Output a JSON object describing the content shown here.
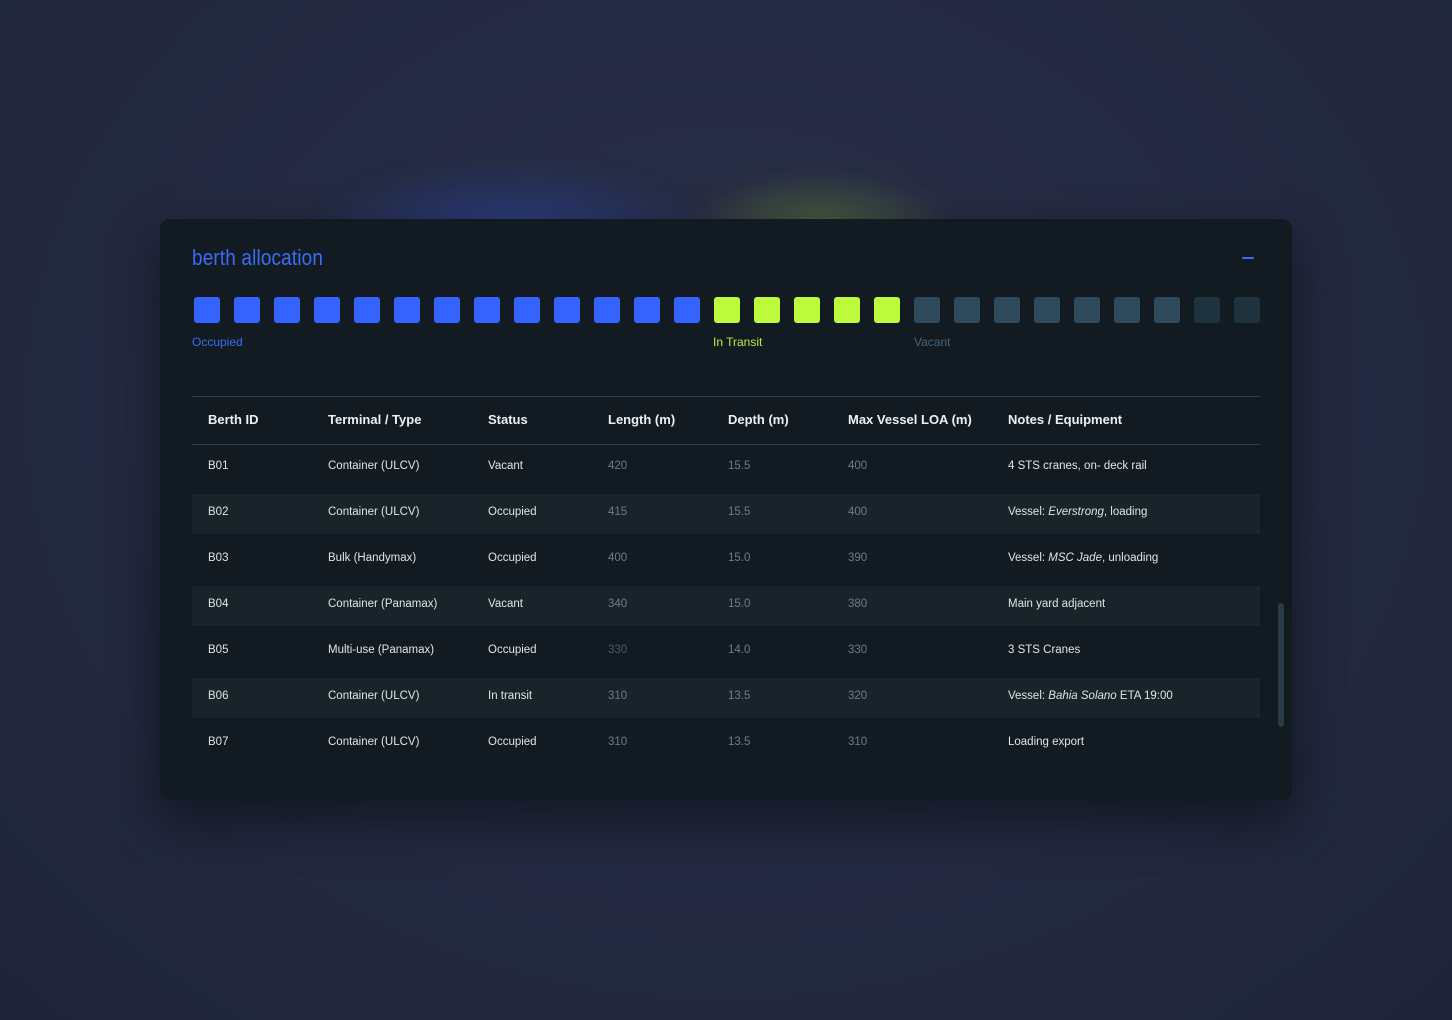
{
  "panel": {
    "title": "berth allocation",
    "collapse_label": "−"
  },
  "colors": {
    "occupied": "#3563ff",
    "in_transit": "#befa3c",
    "vacant": "#2f4a5d",
    "accent": "#3b6cf6"
  },
  "berth_map": {
    "occupied_count": 13,
    "in_transit_count": 5,
    "vacant_count": 9,
    "legend": {
      "occupied": "Occupied",
      "in_transit": "In Transit",
      "vacant": "Vacant"
    }
  },
  "table": {
    "headers": [
      "Berth ID",
      "Terminal / Type",
      "Status",
      "Length (m)",
      "Depth (m)",
      "Max Vessel LOA (m)",
      "Notes / Equipment"
    ],
    "rows": [
      {
        "id": "B01",
        "type": "Container (ULCV)",
        "status": "Vacant",
        "length": "420",
        "depth": "15.5",
        "loa": "400",
        "notes": "4 STS cranes, on- deck rail"
      },
      {
        "id": "B02",
        "type": "Container (ULCV)",
        "status": "Occupied",
        "length": "415",
        "depth": "15.5",
        "loa": "400",
        "notes_prefix": "Vessel: ",
        "vessel": "Everstrong",
        "notes_suffix": ", loading"
      },
      {
        "id": "B03",
        "type": "Bulk (Handymax)",
        "status": "Occupied",
        "length": "400",
        "depth": "15.0",
        "loa": "390",
        "notes_prefix": "Vessel: ",
        "vessel": "MSC Jade",
        "notes_suffix": ", unloading"
      },
      {
        "id": "B04",
        "type": "Container (Panamax)",
        "status": "Vacant",
        "length": "340",
        "depth": "15.0",
        "loa": "380",
        "notes": "Main yard adjacent"
      },
      {
        "id": "B05",
        "type": "Multi-use (Panamax)",
        "status": "Occupied",
        "length": "330",
        "depth": "14.0",
        "loa": "330",
        "notes": "3 STS Cranes"
      },
      {
        "id": "B06",
        "type": "Container (ULCV)",
        "status": "In transit",
        "length": "310",
        "depth": "13.5",
        "loa": "320",
        "notes_prefix": "Vessel: ",
        "vessel": "Bahia Solano",
        "notes_suffix": " ETA 19:00"
      },
      {
        "id": "B07",
        "type": "Container (ULCV)",
        "status": "Occupied",
        "length": "310",
        "depth": "13.5",
        "loa": "310",
        "notes": "Loading export"
      }
    ]
  }
}
